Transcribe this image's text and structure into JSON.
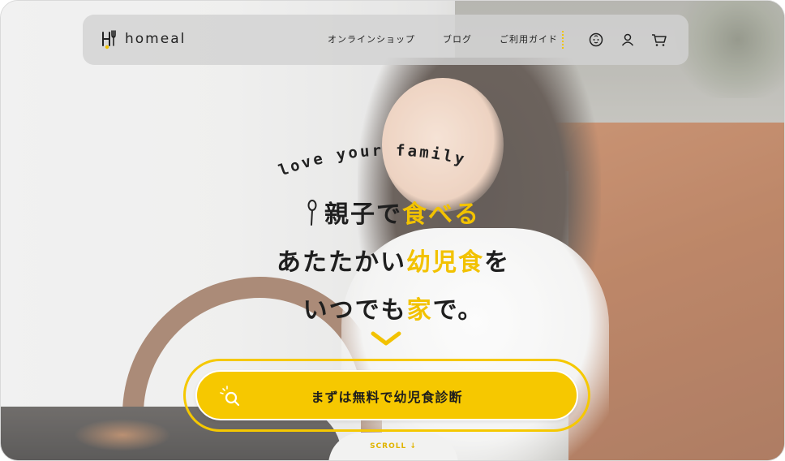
{
  "logo": {
    "text": "homeal"
  },
  "nav": {
    "items": [
      {
        "label": "オンラインショップ"
      },
      {
        "label": "ブログ"
      },
      {
        "label": "ご利用ガイド"
      }
    ]
  },
  "header_icons": [
    "baby-face-icon",
    "account-icon",
    "cart-icon"
  ],
  "hero": {
    "tagline": "love your family",
    "line1_pre": "親子で",
    "line1_accent": "食べる",
    "line2_pre": "あたたかい",
    "line2_accent": "幼児食",
    "line2_post": "を",
    "line3_pre": "いつでも",
    "line3_accent": "家",
    "line3_post": "で。"
  },
  "cta": {
    "label": "まずは無料で幼児食診断",
    "icon": "search-icon"
  },
  "scroll": {
    "label": "SCROLL"
  },
  "colors": {
    "accent": "#f6c800",
    "text": "#1f1f1f",
    "header_bg": "#d2d2d2"
  }
}
